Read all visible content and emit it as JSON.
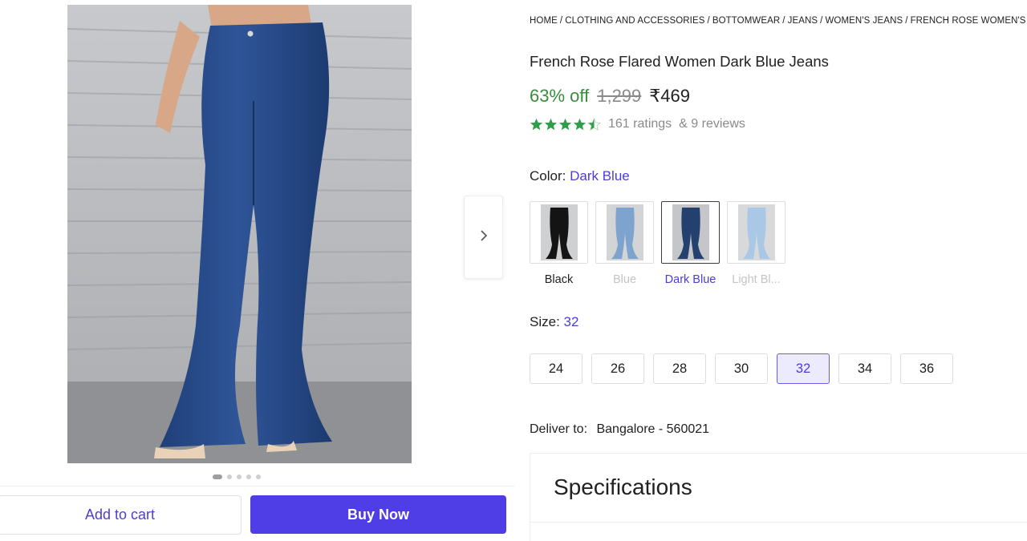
{
  "gallery": {
    "image_alt": "Dark blue flared jeans worn by model",
    "dots_total": 5,
    "dots_active": 1
  },
  "actions": {
    "add_to_cart": "Add to cart",
    "buy_now": "Buy Now"
  },
  "breadcrumb": [
    "HOME",
    "CLOTHING AND ACCESSORIES",
    "BOTTOMWEAR",
    "JEANS",
    "WOMEN'S JEANS",
    "FRENCH ROSE WOMEN'S"
  ],
  "product": {
    "title": "French Rose Flared Women Dark Blue Jeans",
    "discount": "63% off",
    "mrp": "1,299",
    "price": "₹469",
    "rating_stars": 4.5,
    "ratings_text": "161 ratings",
    "reviews_text": "& 9 reviews"
  },
  "color": {
    "label": "Color:",
    "selected": "Dark Blue",
    "options": [
      {
        "name": "Black",
        "shade": "#141414",
        "state": "available"
      },
      {
        "name": "Blue",
        "shade": "#7ea3cf",
        "state": "faded"
      },
      {
        "name": "Dark Blue",
        "shade": "#24406e",
        "state": "selected"
      },
      {
        "name": "Light Bl...",
        "shade": "#a9c8e6",
        "state": "faded"
      }
    ]
  },
  "size": {
    "label": "Size:",
    "selected": "32",
    "options": [
      "24",
      "26",
      "28",
      "30",
      "32",
      "34",
      "36"
    ]
  },
  "delivery": {
    "label": "Deliver to:",
    "location": "Bangalore - 560021"
  },
  "specifications": {
    "heading": "Specifications"
  },
  "colors": {
    "accent": "#4f3de6",
    "accent_text": "#4b3dd6",
    "discount_green": "#388e3c",
    "star_green": "#2e9e4a"
  },
  "icons": {
    "next": "chevron-right-icon",
    "star": "star-icon"
  }
}
